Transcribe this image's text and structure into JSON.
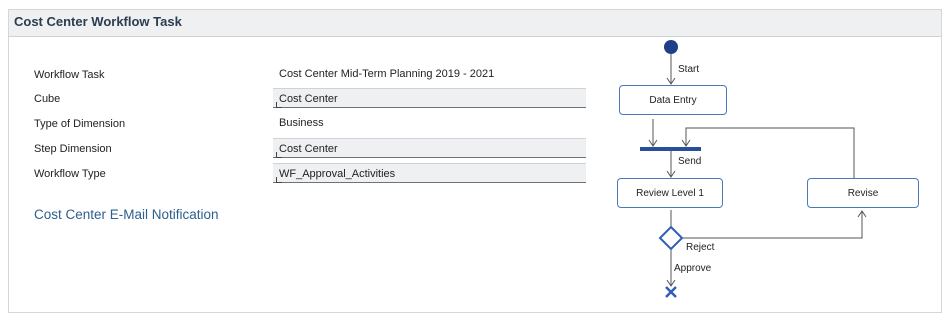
{
  "panel": {
    "title": "Cost Center Workflow Task"
  },
  "fields": [
    {
      "label": "Workflow Task",
      "value": "Cost Center Mid-Term Planning 2019 - 2021"
    },
    {
      "label": "Cube",
      "value": "Cost Center"
    },
    {
      "label": "Type of Dimension",
      "value": "Business"
    },
    {
      "label": "Step Dimension",
      "value": "Cost Center"
    },
    {
      "label": "Workflow Type",
      "value": "WF_Approval_Activities"
    }
  ],
  "notification_link": "Cost Center E-Mail Notification",
  "workflow": {
    "start_label": "Start",
    "data_entry": "Data Entry",
    "send_label": "Send",
    "review_level_1": "Review Level 1",
    "revise": "Revise",
    "reject_label": "Reject",
    "approve_label": "Approve",
    "colors": {
      "node_border": "#4a79b8",
      "start_fill": "#1f3f88",
      "sync_bar": "#2a4f9a",
      "end_mark": "#2f5fb5",
      "line": "#555555"
    }
  }
}
